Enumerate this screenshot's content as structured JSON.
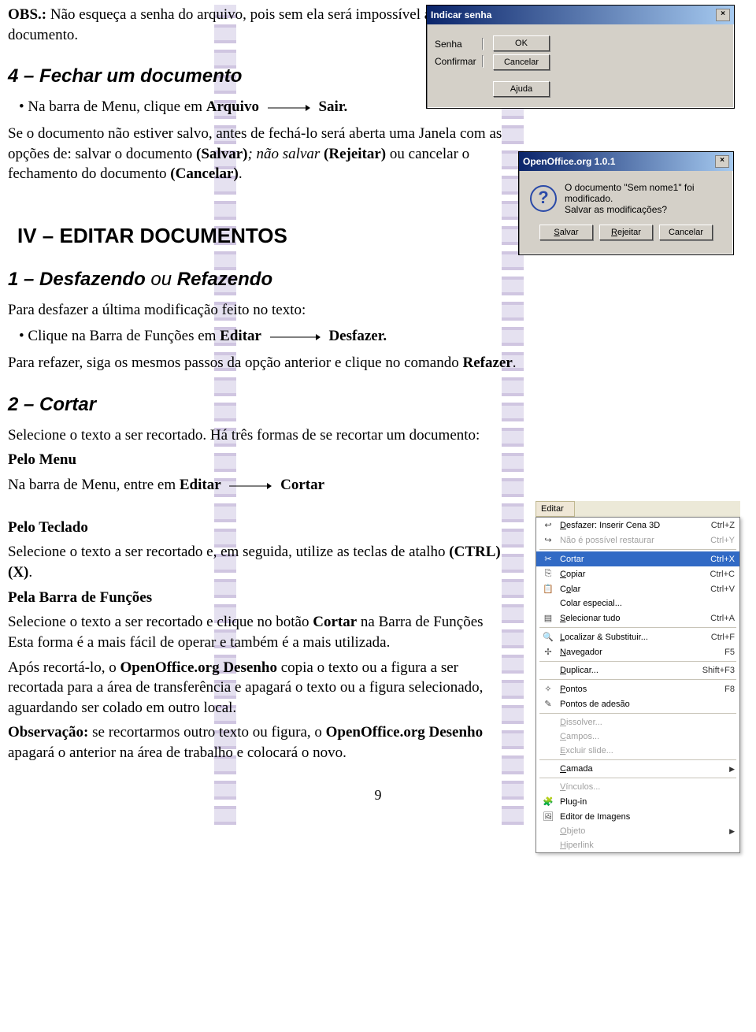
{
  "doc": {
    "obs_label": "OBS.:",
    "obs_text": "Não esqueça a senha do arquivo, pois sem ela será impossível abrir o documento.",
    "h4": "4 – Fechar um documento",
    "b41a": "Na barra de Menu, clique em ",
    "b41_arq": "Arquivo",
    "b41_sair": "Sair.",
    "p42a": "Se o documento não estiver salvo, antes de fechá-lo será aberta uma Janela com as opções de: salvar o documento ",
    "p42_salvar": "(Salvar)",
    "p42b": "; não salvar ",
    "p42_rejeitar": "(Rejeitar)",
    "p42c": " ou cancelar o fechamento do documento ",
    "p42_cancelar": "(Cancelar)",
    "p42d": ".",
    "h_iv": "IV – EDITAR DOCUMENTOS",
    "h1": "1 – Desfazendo ",
    "h1_ou": "ou",
    "h1_b": "  Refazendo",
    "p11": "Para desfazer a última modificação feito no texto:",
    "b12a": "Clique na Barra de Funções em ",
    "b12_editar": "Editar",
    "b12_desfazer": "Desfazer.",
    "p13a": "Para refazer, siga os mesmos passos da opção anterior e clique no comando ",
    "p13_refazer": "Refazer",
    "p13b": ".",
    "h2": "2 – Cortar",
    "p21": "Selecione o texto a ser recortado. Há três formas de se recortar um documento:",
    "p22": "Pelo Menu",
    "p23a": "Na barra de Menu, entre em ",
    "p23_editar": "Editar",
    "p23_cortar": "Cortar",
    "p24": "Pelo Teclado",
    "p25a": "Selecione o texto a ser recortado e, em seguida, utilize as teclas de atalho ",
    "p25_ctrlx": "(CTRL) (X)",
    "p25b": ".",
    "p26": "Pela Barra de Funções",
    "p27a": "Selecione o texto a ser recortado e clique no botão ",
    "p27_cortar": "Cortar",
    "p27b": " na Barra de Funções Esta forma é a mais fácil de operar e também é a mais utilizada.",
    "p28a": "Após recortá-lo, o ",
    "p28_oo": "OpenOffice.org Desenho",
    "p28b": " copia o texto ou a figura a ser recortada para a área de transferência e apagará o texto ou a figura selecionado, aguardando ser colado em outro local.",
    "p29a": "Observação:",
    "p29b": " se recortarmos outro texto ou figura, o ",
    "p29_oo": "OpenOffice.org Desenho",
    "p29c": " apagará o anterior na área de trabalho e colocará o novo.",
    "pagenum": "9"
  },
  "dlg_senha": {
    "title": "Indicar senha",
    "lbl_senha": "Senha",
    "lbl_conf": "Confirmar",
    "btn_ok": "OK",
    "btn_cancel": "Cancelar",
    "btn_help": "Ajuda"
  },
  "dlg_msg": {
    "title": "OpenOffice.org 1.0.1",
    "line1": "O documento \"Sem nome1\" foi modificado.",
    "line2": "Salvar as modificações?",
    "btn_salvar": "Salvar",
    "btn_rejeitar": "Rejeitar",
    "btn_cancelar": "Cancelar"
  },
  "menu": {
    "title": "Editar",
    "items": [
      {
        "icon": "↩",
        "label": "Desfazer: Inserir Cena 3D",
        "u": "D",
        "shortcut": "Ctrl+Z",
        "sel": false,
        "dis": false
      },
      {
        "icon": "↪",
        "label": "Não é possível restaurar",
        "u": "",
        "shortcut": "Ctrl+Y",
        "sel": false,
        "dis": true
      },
      {
        "sep": true
      },
      {
        "icon": "✂",
        "label": "Cortar",
        "u": "",
        "shortcut": "Ctrl+X",
        "sel": true,
        "dis": false
      },
      {
        "icon": "⎘",
        "label": "Copiar",
        "u": "C",
        "shortcut": "Ctrl+C",
        "sel": false,
        "dis": false
      },
      {
        "icon": "📋",
        "label": "Colar",
        "u": "o",
        "shortcut": "Ctrl+V",
        "sel": false,
        "dis": false
      },
      {
        "icon": "",
        "label": "Colar especial...",
        "u": "",
        "shortcut": "",
        "sel": false,
        "dis": false
      },
      {
        "icon": "▤",
        "label": "Selecionar tudo",
        "u": "S",
        "shortcut": "Ctrl+A",
        "sel": false,
        "dis": false
      },
      {
        "sep": true
      },
      {
        "icon": "🔍",
        "label": "Localizar & Substituir...",
        "u": "L",
        "shortcut": "Ctrl+F",
        "sel": false,
        "dis": false
      },
      {
        "icon": "✢",
        "label": "Navegador",
        "u": "N",
        "shortcut": "F5",
        "sel": false,
        "dis": false
      },
      {
        "sep": true
      },
      {
        "icon": "",
        "label": "Duplicar...",
        "u": "D",
        "shortcut": "Shift+F3",
        "sel": false,
        "dis": false
      },
      {
        "sep": true
      },
      {
        "icon": "✧",
        "label": "Pontos",
        "u": "P",
        "shortcut": "F8",
        "sel": false,
        "dis": false
      },
      {
        "icon": "✎",
        "label": "Pontos de adesão",
        "u": "",
        "shortcut": "",
        "sel": false,
        "dis": false
      },
      {
        "sep": true
      },
      {
        "icon": "",
        "label": "Dissolver...",
        "u": "D",
        "shortcut": "",
        "sel": false,
        "dis": true
      },
      {
        "icon": "",
        "label": "Campos...",
        "u": "C",
        "shortcut": "",
        "sel": false,
        "dis": true
      },
      {
        "icon": "",
        "label": "Excluir slide...",
        "u": "E",
        "shortcut": "",
        "sel": false,
        "dis": true
      },
      {
        "sep": true
      },
      {
        "icon": "",
        "label": "Camada",
        "u": "C",
        "shortcut": "",
        "sel": false,
        "dis": false,
        "sub": true
      },
      {
        "sep": true
      },
      {
        "icon": "",
        "label": "Vínculos...",
        "u": "V",
        "shortcut": "",
        "sel": false,
        "dis": true
      },
      {
        "icon": "🧩",
        "label": "Plug-in",
        "u": "",
        "shortcut": "",
        "sel": false,
        "dis": false
      },
      {
        "icon": "🖼",
        "label": "Editor de Imagens",
        "u": "",
        "shortcut": "",
        "sel": false,
        "dis": false
      },
      {
        "icon": "",
        "label": "Objeto",
        "u": "O",
        "shortcut": "",
        "sel": false,
        "dis": true,
        "sub": true
      },
      {
        "icon": "",
        "label": "Hiperlink",
        "u": "H",
        "shortcut": "",
        "sel": false,
        "dis": true
      }
    ]
  }
}
